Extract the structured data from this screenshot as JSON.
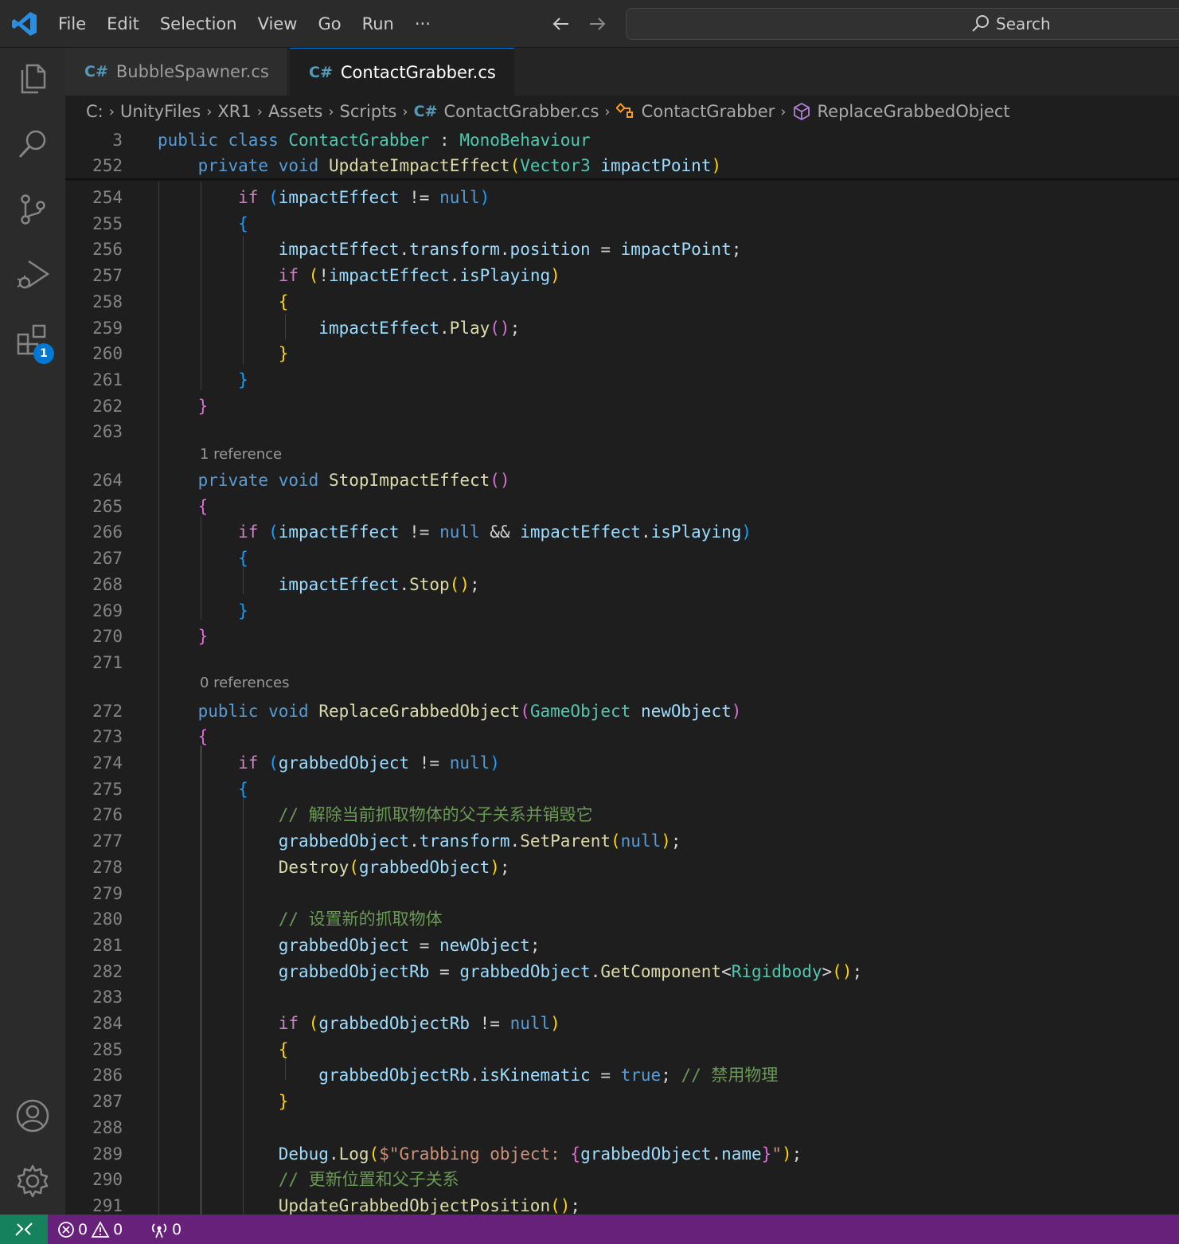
{
  "menu": [
    "File",
    "Edit",
    "Selection",
    "View",
    "Go",
    "Run",
    "···"
  ],
  "search": {
    "label": "Search"
  },
  "activity": {
    "extensions_badge": "1"
  },
  "tabs": [
    {
      "icon": "C#",
      "label": "BubbleSpawner.cs"
    },
    {
      "icon": "C#",
      "label": "ContactGrabber.cs"
    }
  ],
  "breadcrumb": [
    "C:",
    "UnityFiles",
    "XR1",
    "Assets",
    "Scripts",
    "ContactGrabber.cs",
    "ContactGrabber",
    "ReplaceGrabbedObject"
  ],
  "sticky": [
    {
      "ln": "3",
      "code": "public class ContactGrabber : MonoBehaviour"
    },
    {
      "ln": "252",
      "code": "    private void UpdateImpactEffect(Vector3 impactPoint)"
    }
  ],
  "lenses": {
    "stop": "1 reference",
    "replace": "0 references"
  },
  "lines": [
    {
      "ln": "254",
      "code": "        if (impactEffect != null)"
    },
    {
      "ln": "255",
      "code": "        {"
    },
    {
      "ln": "256",
      "code": "            impactEffect.transform.position = impactPoint;"
    },
    {
      "ln": "257",
      "code": "            if (!impactEffect.isPlaying)"
    },
    {
      "ln": "258",
      "code": "            {"
    },
    {
      "ln": "259",
      "code": "                impactEffect.Play();"
    },
    {
      "ln": "260",
      "code": "            }"
    },
    {
      "ln": "261",
      "code": "        }"
    },
    {
      "ln": "262",
      "code": "    }"
    },
    {
      "ln": "263",
      "code": ""
    },
    {
      "ln": "264",
      "code": "    private void StopImpactEffect()"
    },
    {
      "ln": "265",
      "code": "    {"
    },
    {
      "ln": "266",
      "code": "        if (impactEffect != null && impactEffect.isPlaying)"
    },
    {
      "ln": "267",
      "code": "        {"
    },
    {
      "ln": "268",
      "code": "            impactEffect.Stop();"
    },
    {
      "ln": "269",
      "code": "        }"
    },
    {
      "ln": "270",
      "code": "    }"
    },
    {
      "ln": "271",
      "code": ""
    },
    {
      "ln": "272",
      "code": "    public void ReplaceGrabbedObject(GameObject newObject)"
    },
    {
      "ln": "273",
      "code": "    {"
    },
    {
      "ln": "274",
      "code": "        if (grabbedObject != null)"
    },
    {
      "ln": "275",
      "code": "        {"
    },
    {
      "ln": "276",
      "code": "            // 解除当前抓取物体的父子关系并销毁它"
    },
    {
      "ln": "277",
      "code": "            grabbedObject.transform.SetParent(null);"
    },
    {
      "ln": "278",
      "code": "            Destroy(grabbedObject);"
    },
    {
      "ln": "279",
      "code": ""
    },
    {
      "ln": "280",
      "code": "            // 设置新的抓取物体"
    },
    {
      "ln": "281",
      "code": "            grabbedObject = newObject;"
    },
    {
      "ln": "282",
      "code": "            grabbedObjectRb = grabbedObject.GetComponent<Rigidbody>();"
    },
    {
      "ln": "283",
      "code": ""
    },
    {
      "ln": "284",
      "code": "            if (grabbedObjectRb != null)"
    },
    {
      "ln": "285",
      "code": "            {"
    },
    {
      "ln": "286",
      "code": "                grabbedObjectRb.isKinematic = true; // 禁用物理"
    },
    {
      "ln": "287",
      "code": "            }"
    },
    {
      "ln": "288",
      "code": ""
    },
    {
      "ln": "289",
      "code": "            Debug.Log($\"Grabbing object: {grabbedObject.name}\");"
    },
    {
      "ln": "290",
      "code": "            // 更新位置和父子关系"
    },
    {
      "ln": "291",
      "code": "            UpdateGrabbedObjectPosition();"
    }
  ],
  "status": {
    "errors": "0",
    "warnings": "0",
    "ports": "0"
  },
  "colors": {
    "accent": "#0078d4",
    "status_bar": "#68217a",
    "remote": "#16825d"
  }
}
